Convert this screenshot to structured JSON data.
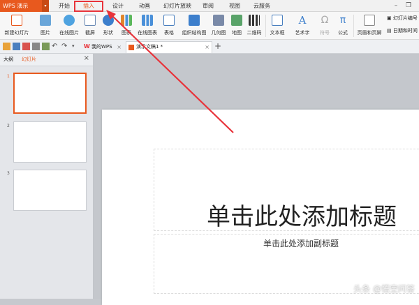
{
  "app": {
    "logo_label": "WPS 演示"
  },
  "menu": {
    "tabs": [
      {
        "label": "开始"
      },
      {
        "label": "插入"
      },
      {
        "label": "设计"
      },
      {
        "label": "动画"
      },
      {
        "label": "幻灯片放映"
      },
      {
        "label": "审阅"
      },
      {
        "label": "视图"
      },
      {
        "label": "云服务"
      }
    ],
    "active_tab": "插入"
  },
  "ribbon": {
    "items": [
      {
        "label": "新建幻灯片",
        "icon": "new-slide-icon"
      },
      {
        "label": "图片",
        "icon": "picture-icon"
      },
      {
        "label": "在线图片",
        "icon": "online-picture-icon"
      },
      {
        "label": "截屏",
        "icon": "screenshot-icon"
      },
      {
        "label": "形状",
        "icon": "shapes-icon"
      },
      {
        "label": "图表",
        "icon": "chart-icon"
      },
      {
        "label": "在线图表",
        "icon": "online-chart-icon"
      },
      {
        "label": "表格",
        "icon": "table-icon"
      },
      {
        "label": "组织结构图",
        "icon": "org-chart-icon"
      },
      {
        "label": "几何图",
        "icon": "geometry-icon"
      },
      {
        "label": "地图",
        "icon": "map-icon"
      },
      {
        "label": "二维码",
        "icon": "qrcode-icon"
      },
      {
        "label": "文本框",
        "icon": "textbox-icon"
      },
      {
        "label": "艺术字",
        "icon": "wordart-icon"
      },
      {
        "label": "符号",
        "icon": "symbol-icon"
      },
      {
        "label": "公式",
        "icon": "formula-icon"
      },
      {
        "label": "页眉和页脚",
        "icon": "header-footer-icon"
      },
      {
        "label": "幻灯片编号",
        "icon": "slide-number-icon"
      },
      {
        "label": "日期和时间",
        "icon": "datetime-icon"
      }
    ]
  },
  "doc_tabs": [
    {
      "label": "我的WPS"
    },
    {
      "label": "演示文稿1 *"
    }
  ],
  "left_panel": {
    "tabs": [
      {
        "label": "大纲"
      },
      {
        "label": "幻灯片"
      }
    ],
    "slides": [
      {
        "number": "1"
      },
      {
        "number": "2"
      },
      {
        "number": "3"
      }
    ],
    "selected": "1"
  },
  "slide": {
    "title_placeholder": "单击此处添加标题",
    "subtitle_placeholder": "单击此处添加副标题"
  },
  "watermark": "头条 @悟空问答",
  "colors": {
    "accent": "#e8591e",
    "annotation_red": "#e8333a"
  }
}
